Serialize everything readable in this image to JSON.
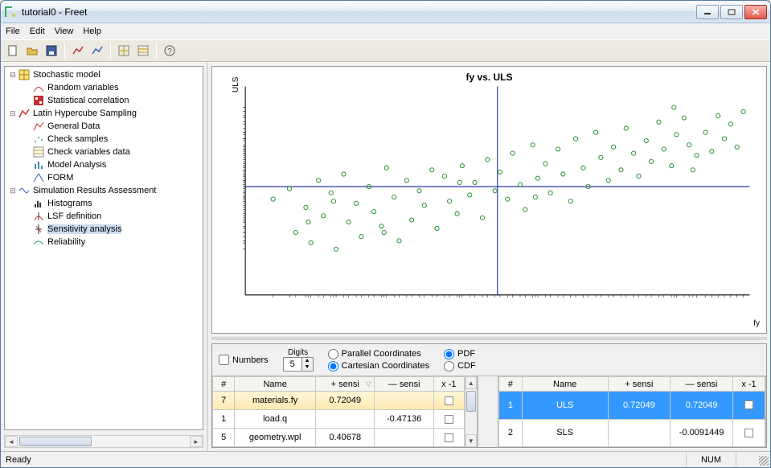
{
  "window": {
    "title": "tutorial0 - Freet"
  },
  "menu": {
    "file": "File",
    "edit": "Edit",
    "view": "View",
    "help": "Help"
  },
  "toolbar_icons": [
    "new",
    "open",
    "save",
    "chart-a",
    "chart-b",
    "grid-a",
    "grid-b",
    "help"
  ],
  "tree": [
    {
      "depth": 1,
      "exp": "-",
      "icon": "grid-yellow",
      "label": "Stochastic model"
    },
    {
      "depth": 2,
      "exp": "",
      "icon": "curve",
      "label": "Random variables"
    },
    {
      "depth": 2,
      "exp": "",
      "icon": "matrix",
      "label": "Statistical correlation"
    },
    {
      "depth": 1,
      "exp": "-",
      "icon": "chart-red",
      "label": "Latin Hypercube Sampling"
    },
    {
      "depth": 2,
      "exp": "",
      "icon": "plot-red",
      "label": "General Data"
    },
    {
      "depth": 2,
      "exp": "",
      "icon": "dots",
      "label": "Check samples"
    },
    {
      "depth": 2,
      "exp": "",
      "icon": "grid-small",
      "label": "Check variables data"
    },
    {
      "depth": 2,
      "exp": "",
      "icon": "stats",
      "label": "Model Analysis"
    },
    {
      "depth": 2,
      "exp": "",
      "icon": "form",
      "label": "FORM"
    },
    {
      "depth": 1,
      "exp": "-",
      "icon": "wave",
      "label": "Simulation Results Assessment"
    },
    {
      "depth": 2,
      "exp": "",
      "icon": "histo",
      "label": "Histograms"
    },
    {
      "depth": 2,
      "exp": "",
      "icon": "lsf",
      "label": "LSF definition"
    },
    {
      "depth": 2,
      "exp": "",
      "icon": "sens",
      "label": "Sensitivity analysis",
      "selected": true
    },
    {
      "depth": 2,
      "exp": "",
      "icon": "reliab",
      "label": "Reliability"
    }
  ],
  "chart_data": {
    "type": "scatter",
    "title": "fy vs. ULS",
    "xlabel": "fy",
    "ylabel": "ULS",
    "xlim": [
      300,
      700
    ],
    "ylim": [
      0,
      100
    ],
    "crosshair": {
      "x": 500,
      "y": 52
    },
    "points": [
      [
        322,
        46
      ],
      [
        335,
        51
      ],
      [
        340,
        30
      ],
      [
        348,
        42
      ],
      [
        352,
        25
      ],
      [
        358,
        55
      ],
      [
        362,
        38
      ],
      [
        368,
        49
      ],
      [
        372,
        22
      ],
      [
        378,
        58
      ],
      [
        382,
        35
      ],
      [
        388,
        44
      ],
      [
        392,
        28
      ],
      [
        398,
        52
      ],
      [
        402,
        40
      ],
      [
        408,
        33
      ],
      [
        412,
        61
      ],
      [
        418,
        47
      ],
      [
        422,
        26
      ],
      [
        428,
        55
      ],
      [
        432,
        36
      ],
      [
        438,
        50
      ],
      [
        442,
        43
      ],
      [
        448,
        60
      ],
      [
        452,
        32
      ],
      [
        458,
        57
      ],
      [
        462,
        45
      ],
      [
        468,
        39
      ],
      [
        472,
        62
      ],
      [
        478,
        48
      ],
      [
        482,
        54
      ],
      [
        488,
        37
      ],
      [
        492,
        65
      ],
      [
        498,
        50
      ],
      [
        502,
        59
      ],
      [
        508,
        46
      ],
      [
        512,
        68
      ],
      [
        518,
        53
      ],
      [
        522,
        41
      ],
      [
        528,
        72
      ],
      [
        532,
        56
      ],
      [
        538,
        63
      ],
      [
        542,
        49
      ],
      [
        548,
        70
      ],
      [
        552,
        58
      ],
      [
        558,
        45
      ],
      [
        562,
        75
      ],
      [
        568,
        61
      ],
      [
        572,
        52
      ],
      [
        578,
        78
      ],
      [
        582,
        66
      ],
      [
        588,
        55
      ],
      [
        592,
        71
      ],
      [
        598,
        60
      ],
      [
        602,
        80
      ],
      [
        608,
        68
      ],
      [
        612,
        57
      ],
      [
        618,
        74
      ],
      [
        622,
        64
      ],
      [
        628,
        83
      ],
      [
        632,
        70
      ],
      [
        638,
        62
      ],
      [
        642,
        77
      ],
      [
        648,
        85
      ],
      [
        652,
        72
      ],
      [
        658,
        67
      ],
      [
        640,
        90
      ],
      [
        665,
        78
      ],
      [
        670,
        69
      ],
      [
        675,
        86
      ],
      [
        680,
        75
      ],
      [
        685,
        82
      ],
      [
        690,
        71
      ],
      [
        695,
        88
      ],
      [
        655,
        60
      ],
      [
        530,
        47
      ],
      [
        470,
        54
      ],
      [
        410,
        30
      ],
      [
        370,
        45
      ],
      [
        350,
        35
      ]
    ]
  },
  "controls": {
    "numbers_label": "Numbers",
    "digits_label": "Digits",
    "digits_value": "5",
    "parallel": "Parallel Coordinates",
    "cartesian": "Cartesian Coordinates",
    "pdf": "PDF",
    "cdf": "CDF"
  },
  "table_left": {
    "headers": {
      "idx": "#",
      "name": "Name",
      "psensi": "+ sensi",
      "msensi": "— sensi",
      "x1": "x -1"
    },
    "rows": [
      {
        "idx": "7",
        "name": "materials.fy",
        "psensi": "0.72049",
        "msensi": "",
        "sel": true
      },
      {
        "idx": "1",
        "name": "load.q",
        "psensi": "",
        "msensi": "-0.47136"
      },
      {
        "idx": "5",
        "name": "geometry.wpl",
        "psensi": "0.40678",
        "msensi": ""
      }
    ]
  },
  "table_right": {
    "headers": {
      "idx": "#",
      "name": "Name",
      "psensi": "+ sensi",
      "msensi": "— sensi",
      "x1": "x -1"
    },
    "rows": [
      {
        "idx": "1",
        "name": "ULS",
        "psensi": "0.72049",
        "msensi": "0.72049",
        "sel": true
      },
      {
        "idx": "2",
        "name": "SLS",
        "psensi": "",
        "msensi": "-0.0091449"
      }
    ]
  },
  "status": {
    "ready": "Ready",
    "num": "NUM"
  }
}
